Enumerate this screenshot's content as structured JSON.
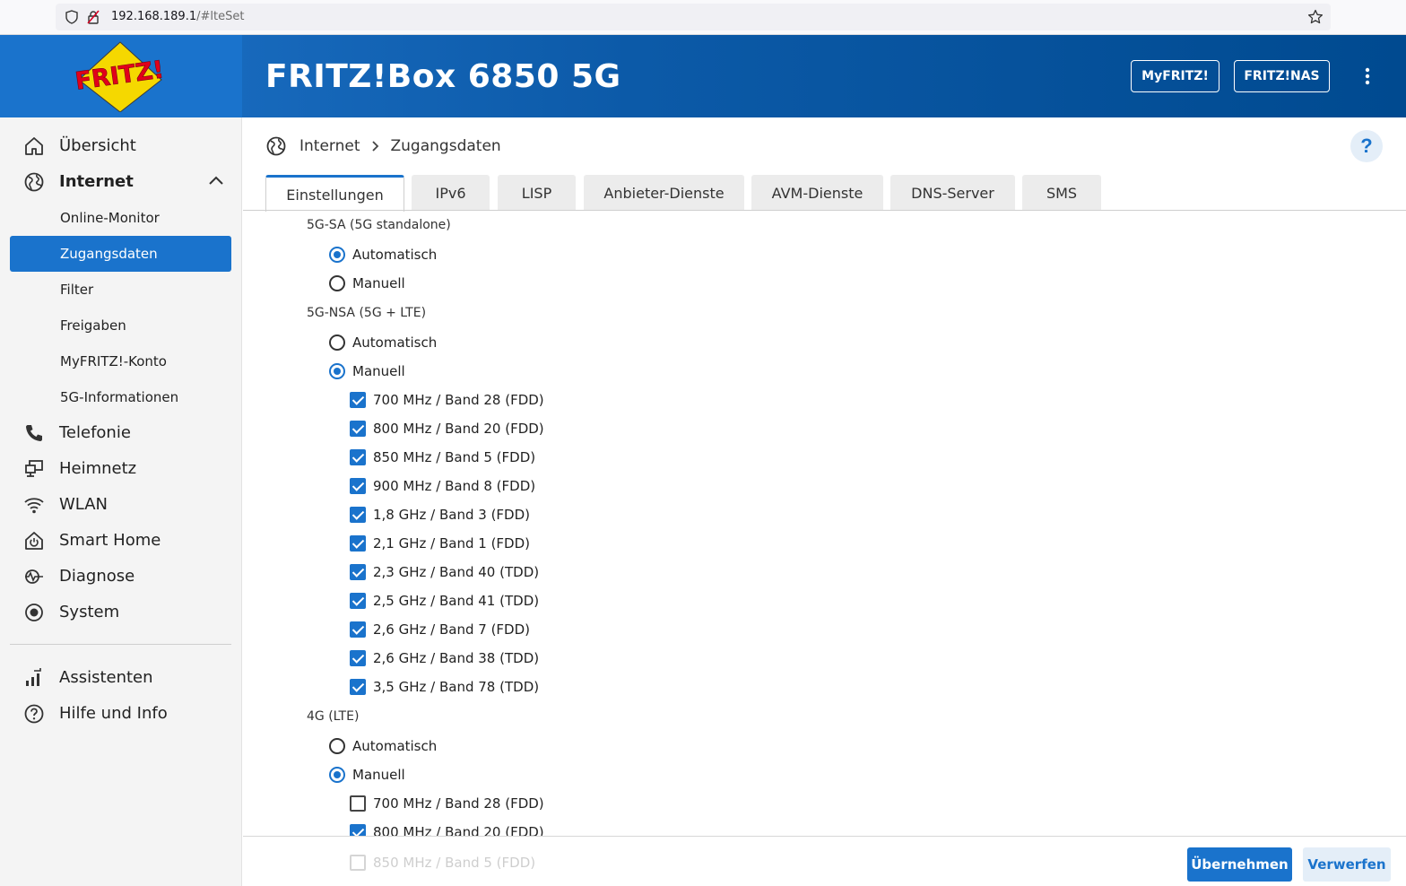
{
  "browser": {
    "url_host": "192.168.189.1",
    "url_path": "/#lteSet"
  },
  "header": {
    "logo_text": "FRITZ!",
    "product_title": "FRITZ!Box 6850 5G",
    "myfritz_label": "MyFRITZ!",
    "fritznas_label": "FRITZ!NAS"
  },
  "sidebar": {
    "items": [
      {
        "label": "Übersicht",
        "icon": "home-icon"
      },
      {
        "label": "Internet",
        "icon": "globe-icon"
      },
      {
        "label": "Telefonie",
        "icon": "phone-icon"
      },
      {
        "label": "Heimnetz",
        "icon": "network-icon"
      },
      {
        "label": "WLAN",
        "icon": "wifi-icon"
      },
      {
        "label": "Smart Home",
        "icon": "power-icon"
      },
      {
        "label": "Diagnose",
        "icon": "diagnose-icon"
      },
      {
        "label": "System",
        "icon": "system-icon"
      },
      {
        "label": "Assistenten",
        "icon": "assistant-icon"
      },
      {
        "label": "Hilfe und Info",
        "icon": "help-icon"
      }
    ],
    "internet_sub": [
      {
        "label": "Online-Monitor"
      },
      {
        "label": "Zugangsdaten",
        "active": true
      },
      {
        "label": "Filter"
      },
      {
        "label": "Freigaben"
      },
      {
        "label": "MyFRITZ!-Konto"
      },
      {
        "label": "5G-Informationen"
      }
    ]
  },
  "breadcrumb": {
    "parent": "Internet",
    "current": "Zugangsdaten"
  },
  "help_label": "?",
  "tabs": [
    {
      "label": "Einstellungen",
      "active": true
    },
    {
      "label": "IPv6"
    },
    {
      "label": "LISP"
    },
    {
      "label": "Anbieter-Dienste"
    },
    {
      "label": "AVM-Dienste"
    },
    {
      "label": "DNS-Server"
    },
    {
      "label": "SMS"
    }
  ],
  "form": {
    "sa": {
      "title": "5G-SA (5G standalone)",
      "auto_label": "Automatisch",
      "manual_label": "Manuell",
      "selected": "auto"
    },
    "nsa": {
      "title": "5G-NSA (5G + LTE)",
      "auto_label": "Automatisch",
      "manual_label": "Manuell",
      "selected": "manual",
      "bands": [
        {
          "label": "700 MHz / Band 28 (FDD)",
          "checked": true
        },
        {
          "label": "800 MHz / Band 20 (FDD)",
          "checked": true
        },
        {
          "label": "850 MHz / Band 5 (FDD)",
          "checked": true
        },
        {
          "label": "900 MHz / Band 8 (FDD)",
          "checked": true
        },
        {
          "label": "1,8 GHz / Band 3 (FDD)",
          "checked": true
        },
        {
          "label": "2,1 GHz / Band 1 (FDD)",
          "checked": true
        },
        {
          "label": "2,3 GHz / Band 40 (TDD)",
          "checked": true
        },
        {
          "label": "2,5 GHz / Band 41 (TDD)",
          "checked": true
        },
        {
          "label": "2,6 GHz / Band 7 (FDD)",
          "checked": true
        },
        {
          "label": "2,6 GHz / Band 38 (TDD)",
          "checked": true
        },
        {
          "label": "3,5 GHz / Band 78 (TDD)",
          "checked": true
        }
      ]
    },
    "lte": {
      "title": "4G (LTE)",
      "auto_label": "Automatisch",
      "manual_label": "Manuell",
      "selected": "manual",
      "bands": [
        {
          "label": "700 MHz / Band 28 (FDD)",
          "checked": false
        },
        {
          "label": "800 MHz / Band 20 (FDD)",
          "checked": true
        },
        {
          "label": "850 MHz / Band 5 (FDD)",
          "checked": false
        }
      ]
    }
  },
  "actions": {
    "apply_label": "Übernehmen",
    "discard_label": "Verwerfen"
  },
  "colors": {
    "accent": "#1a73cc",
    "header_dark": "#004a90"
  }
}
